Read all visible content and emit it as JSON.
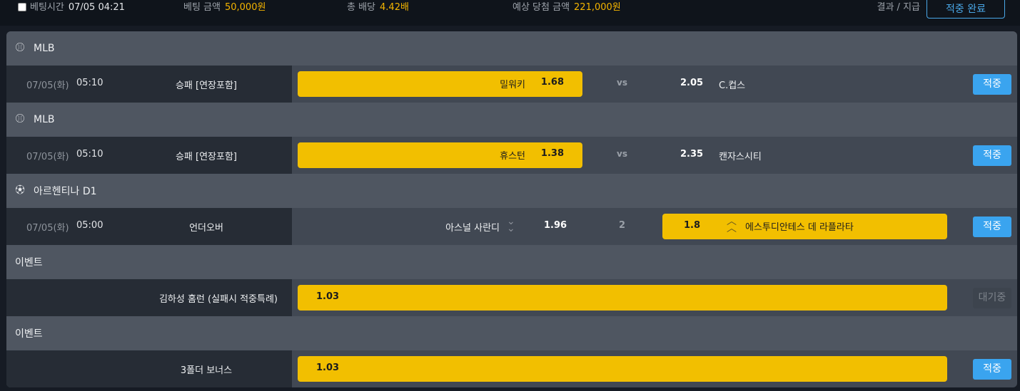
{
  "topbar": {
    "bet_time_label": "베팅시간",
    "bet_time": "07/05 04:21",
    "bet_amount_label": "베팅 금액",
    "bet_amount": "50,000원",
    "total_odds_label": "총 배당",
    "total_odds": "4.42배",
    "expected_win_label": "예상 당첨 금액",
    "expected_win": "221,000원",
    "result_label": "결과 / 지급",
    "status_button": "적중 완료"
  },
  "sections": [
    {
      "league": "MLB",
      "icon": "baseball-icon",
      "date": "07/05(화)",
      "time": "05:10",
      "market": "승패 [연장포함]",
      "home_team": "밀워키",
      "home_odds": "1.68",
      "middle": "vs",
      "away_odds": "2.05",
      "away_team": "C.컵스",
      "status": "적중"
    },
    {
      "league": "MLB",
      "icon": "baseball-icon",
      "date": "07/05(화)",
      "time": "05:10",
      "market": "승패 [연장포함]",
      "home_team": "휴스턴",
      "home_odds": "1.38",
      "middle": "vs",
      "away_odds": "2.35",
      "away_team": "캔자스시티",
      "status": "적중"
    },
    {
      "league": "아르헨티나 D1",
      "icon": "soccer-ball-icon",
      "date": "07/05(화)",
      "time": "05:00",
      "market": "언더오버",
      "home_team": "아스널 사란디",
      "home_odds": "1.96",
      "middle": "2",
      "away_odds": "1.8",
      "away_team": "에스투디안테스 데 라플라타",
      "status": "적중"
    },
    {
      "league": "이벤트",
      "market": "김하성 홈런 (실패시 적중특례)",
      "odds": "1.03",
      "status": "대기중"
    },
    {
      "league": "이벤트",
      "market": "3폴더 보너스",
      "odds": "1.03",
      "status": "적중"
    }
  ],
  "colors": {
    "accent_yellow": "#f2bf00",
    "accent_blue": "#3aa4ef",
    "amount_text": "#f4b400"
  }
}
